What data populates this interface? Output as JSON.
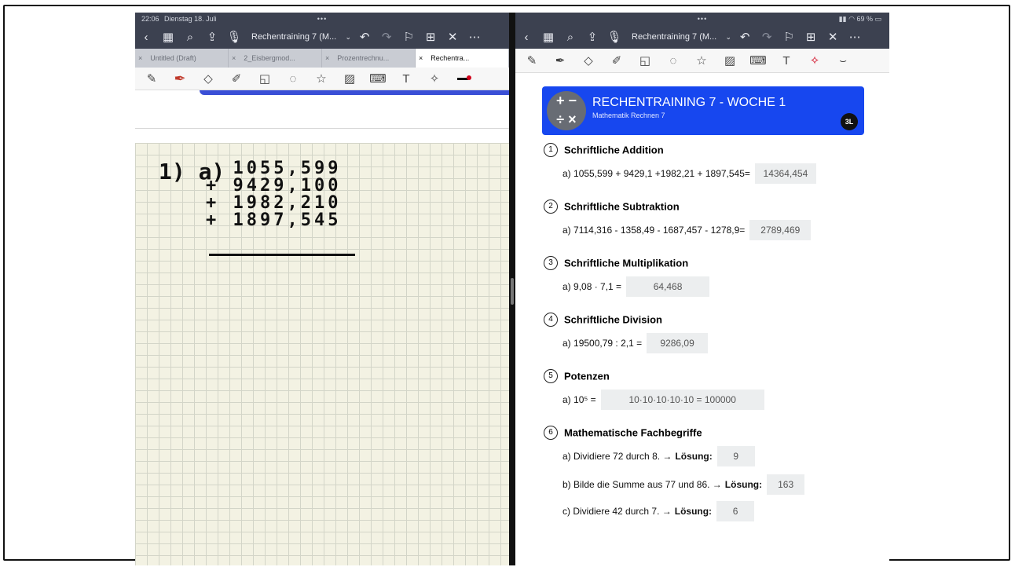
{
  "left_pane": {
    "status": {
      "time": "22:06",
      "date": "Dienstag 18. Juli",
      "dots": "•••"
    },
    "nav": {
      "title": "Rechentraining 7 (M...",
      "icons": [
        "back-icon",
        "grid-icon",
        "search-icon",
        "share-icon",
        "mic-icon",
        "undo-icon",
        "redo-icon",
        "bookmark-icon",
        "add-page-icon",
        "close-icon",
        "more-icon"
      ]
    },
    "tabs": [
      {
        "label": "Untitled (Draft)",
        "close": "×"
      },
      {
        "label": "2_Eisbergmod...",
        "close": "×"
      },
      {
        "label": "Prozentrechnu...",
        "close": "×"
      },
      {
        "label": "Rechentra...",
        "close": "×"
      }
    ],
    "handwriting": {
      "label": "1) a)",
      "lines": [
        "  1055,599",
        "+ 9429,100",
        "+ 1982,210",
        "+ 1897,545"
      ]
    }
  },
  "right_pane": {
    "status": {
      "dots": "•••",
      "battery": "69 %"
    },
    "nav": {
      "title": "Rechentraining 7 (M..."
    },
    "header": {
      "title": "RECHENTRAINING 7 - WOCHE 1",
      "subtitle": "Mathematik Rechnen 7",
      "badge": "3L",
      "logo": "+ −\n÷ ×"
    },
    "sections": [
      {
        "number": "1",
        "title": "Schriftliche Addition",
        "tasks": [
          {
            "label": "a)",
            "text": "1055,599 + 9429,1 +1982,21 + 1897,545=",
            "answer": "14364,454"
          }
        ]
      },
      {
        "number": "2",
        "title": "Schriftliche Subtraktion",
        "tasks": [
          {
            "label": "a)",
            "text": "7114,316 - 1358,49 - 1687,457 - 1278,9=",
            "answer": "2789,469"
          }
        ]
      },
      {
        "number": "3",
        "title": "Schriftliche Multiplikation",
        "tasks": [
          {
            "label": "a)",
            "text": "9,08 · 7,1 =",
            "answer": "64,468"
          }
        ]
      },
      {
        "number": "4",
        "title": "Schriftliche Division",
        "tasks": [
          {
            "label": "a)",
            "text": "19500,79 : 2,1 =",
            "answer": "9286,09"
          }
        ]
      },
      {
        "number": "5",
        "title": "Potenzen",
        "tasks": [
          {
            "label": "a)",
            "text": "10⁵ =",
            "answer": "10·10·10·10·10 = 100000"
          }
        ]
      },
      {
        "number": "6",
        "title": "Mathematische Fachbegriffe",
        "tasks": [
          {
            "label": "a)",
            "text": "Dividiere 72 durch 8. →",
            "solution_label": "Lösung:",
            "answer": "9"
          },
          {
            "label": "b)",
            "text": "Bilde die Summe aus 77 und 86. →",
            "solution_label": "Lösung:",
            "answer": "163"
          },
          {
            "label": "c)",
            "text": "Dividiere 42 durch 7. →",
            "solution_label": "Lösung:",
            "answer": "6"
          }
        ]
      }
    ]
  },
  "colors": {
    "nav_bg": "#3c4150",
    "header_blue": "#1747ef",
    "grid_paper": "#f3f2e3",
    "answer_bg": "#eceeef"
  }
}
